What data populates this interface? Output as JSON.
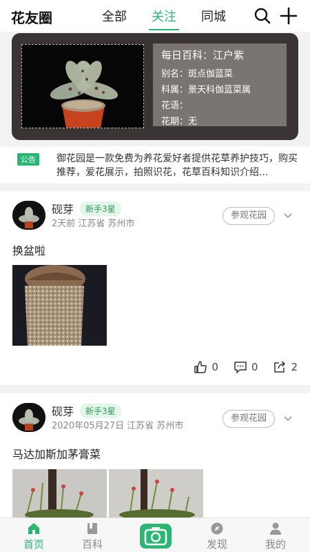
{
  "header": {
    "app_title": "花友圈",
    "tabs": [
      {
        "label": "全部",
        "active": false
      },
      {
        "label": "关注",
        "active": true
      },
      {
        "label": "同城",
        "active": false
      }
    ],
    "icons": [
      "search-icon",
      "plus-icon"
    ]
  },
  "banner": {
    "main": "每日百科：江户紫",
    "alias": "别名：斑点伽蓝菜",
    "family": "科属：景天科伽蓝菜属",
    "language": "花语：",
    "season": "花期：无"
  },
  "notice": {
    "badge": "公告",
    "text": "御花园是一款免费为养花爱好者提供花草养护技巧，购买推荐，爱花展示，拍照识花，花草百科知识介绍..."
  },
  "posts": [
    {
      "author": "砚芽",
      "badge": "新手3星",
      "meta": "2天前  江苏省  苏州市",
      "visit_label": "参观花园",
      "text": "换盆啦",
      "likes": "0",
      "comments": "0",
      "shares": "2"
    },
    {
      "author": "砚芽",
      "badge": "新手3星",
      "meta": "2020年05月27日  江苏省  苏州市",
      "visit_label": "参观花园",
      "text": "马达加斯加茅膏菜"
    }
  ],
  "bottom_nav": [
    {
      "label": "首页",
      "icon": "home-icon",
      "active": true
    },
    {
      "label": "百科",
      "icon": "book-icon",
      "active": false
    },
    {
      "label": "",
      "icon": "camera-icon",
      "active": false
    },
    {
      "label": "发现",
      "icon": "compass-icon",
      "active": false
    },
    {
      "label": "我的",
      "icon": "user-icon",
      "active": false
    }
  ],
  "colors": {
    "accent": "#2bb673",
    "banner_bg": "#3a3534",
    "banner_info_bg": "#7a7573"
  }
}
